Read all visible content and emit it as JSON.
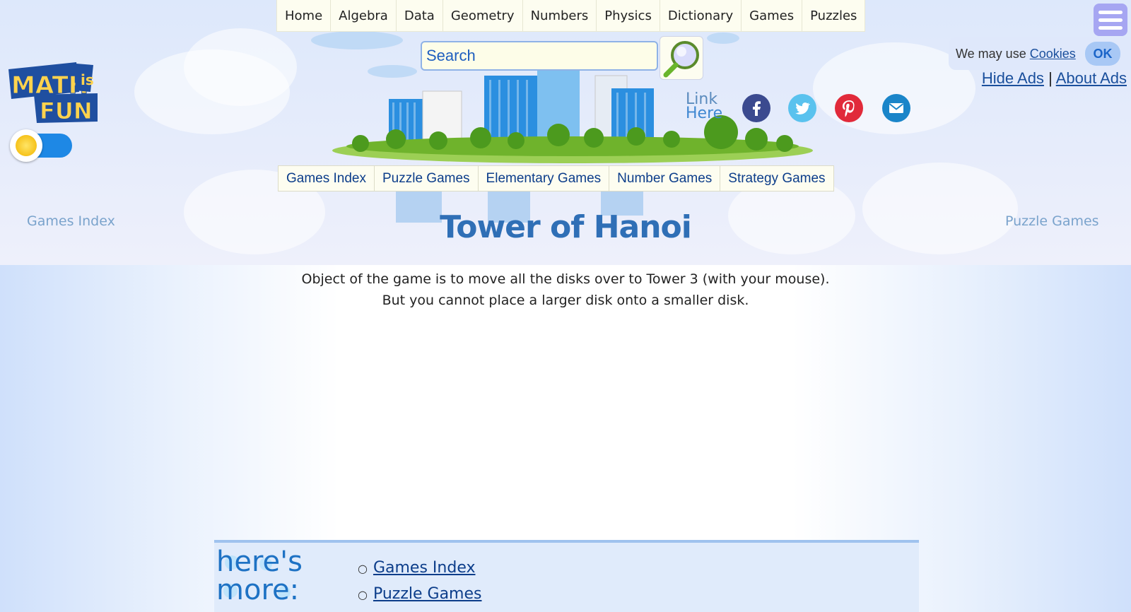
{
  "top_nav": [
    "Home",
    "Algebra",
    "Data",
    "Geometry",
    "Numbers",
    "Physics",
    "Dictionary",
    "Games",
    "Puzzles"
  ],
  "logo": {
    "line1": "MATH",
    "line2": "is",
    "line3": "FUN"
  },
  "search": {
    "placeholder": "Search"
  },
  "cookie": {
    "text": "We may use",
    "link": "Cookies",
    "ok": "OK"
  },
  "ads": {
    "hide": "Hide Ads",
    "separator": "|",
    "about": "About Ads"
  },
  "share": {
    "link_line1": "Link",
    "link_line2": "Here"
  },
  "games_nav": [
    "Games Index",
    "Puzzle Games",
    "Elementary Games",
    "Number Games",
    "Strategy Games"
  ],
  "prev_link": "Games Index",
  "next_link": "Puzzle Games",
  "title": "Tower of Hanoi",
  "intro": {
    "line1": "Object of the game is to move all the disks over to Tower 3 (with your mouse).",
    "line2": "But you cannot place a larger disk onto a smaller disk."
  },
  "more": {
    "heading_line1": "here's",
    "heading_line2": "more:",
    "links": [
      "Games Index",
      "Puzzle Games"
    ]
  },
  "colors": {
    "brand_blue": "#2f6fb6",
    "link_blue": "#0c3d8a",
    "nav_bg": "#fdfdf0",
    "toggle_blue": "#1e88e5"
  }
}
